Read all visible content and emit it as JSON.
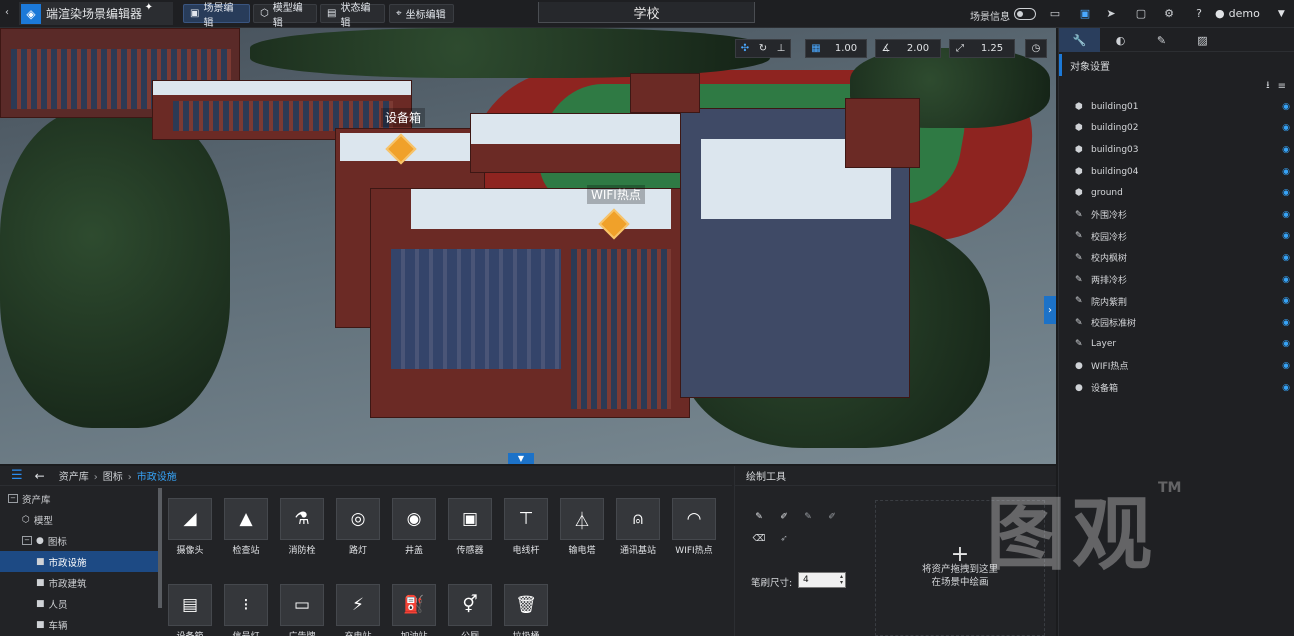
{
  "app": {
    "title": "端渲染场景编辑器",
    "spark": "✦"
  },
  "menu": [
    {
      "label": "场景编辑",
      "icon": "▣"
    },
    {
      "label": "模型编辑",
      "icon": "⬡"
    },
    {
      "label": "状态编辑",
      "icon": "▤"
    },
    {
      "label": "坐标编辑",
      "icon": "⌖"
    }
  ],
  "scene_title": "学校",
  "topright": {
    "scene_info_label": "场景信息",
    "user": "demo"
  },
  "viewport": {
    "grid_value": "1.00",
    "angle_value": "2.00",
    "scale_value": "1.25",
    "poi": [
      {
        "label": "设备箱"
      },
      {
        "label": "WIFI热点"
      }
    ]
  },
  "right_panel": {
    "header": "对象设置",
    "objects": [
      {
        "name": "building01",
        "icon": "cube"
      },
      {
        "name": "building02",
        "icon": "cube"
      },
      {
        "name": "building03",
        "icon": "cube"
      },
      {
        "name": "building04",
        "icon": "cube"
      },
      {
        "name": "ground",
        "icon": "cube"
      },
      {
        "name": "外围冷杉",
        "icon": "brush"
      },
      {
        "name": "校园冷杉",
        "icon": "brush"
      },
      {
        "name": "校内枫树",
        "icon": "brush"
      },
      {
        "name": "两排冷杉",
        "icon": "brush"
      },
      {
        "name": "院内紫荆",
        "icon": "brush"
      },
      {
        "name": "校园标准树",
        "icon": "brush"
      },
      {
        "name": "Layer",
        "icon": "brush"
      },
      {
        "name": "WIFI热点",
        "icon": "pin"
      },
      {
        "name": "设备箱",
        "icon": "pin"
      }
    ]
  },
  "bottom": {
    "breadcrumb": [
      "资产库",
      "图标",
      "市政设施"
    ],
    "tree": [
      {
        "label": "资产库",
        "level": 0,
        "toggle": "−",
        "icon": ""
      },
      {
        "label": "模型",
        "level": 1,
        "toggle": "",
        "icon": "⬡"
      },
      {
        "label": "图标",
        "level": 1,
        "toggle": "−",
        "icon": "●"
      },
      {
        "label": "市政设施",
        "level": 2,
        "toggle": "",
        "icon": "■",
        "selected": true
      },
      {
        "label": "市政建筑",
        "level": 2,
        "toggle": "",
        "icon": "■"
      },
      {
        "label": "人员",
        "level": 2,
        "toggle": "",
        "icon": "■"
      },
      {
        "label": "车辆",
        "level": 2,
        "toggle": "",
        "icon": "■"
      }
    ],
    "assets": [
      {
        "label": "摄像头",
        "glyph": "◢"
      },
      {
        "label": "检查站",
        "glyph": "▲"
      },
      {
        "label": "消防栓",
        "glyph": "⚗"
      },
      {
        "label": "路灯",
        "glyph": "◎"
      },
      {
        "label": "井盖",
        "glyph": "◉"
      },
      {
        "label": "传感器",
        "glyph": "▣"
      },
      {
        "label": "电线杆",
        "glyph": "⊤"
      },
      {
        "label": "输电塔",
        "glyph": "⏃"
      },
      {
        "label": "通讯基站",
        "glyph": "⍝"
      },
      {
        "label": "WIFI热点",
        "glyph": "◠"
      },
      {
        "label": "设备箱",
        "glyph": "▤"
      },
      {
        "label": "信号灯",
        "glyph": "⁝"
      },
      {
        "label": "广告牌",
        "glyph": "▭"
      },
      {
        "label": "充电站",
        "glyph": "⚡"
      },
      {
        "label": "加油站",
        "glyph": "⛽"
      },
      {
        "label": "公厕",
        "glyph": "⚥"
      },
      {
        "label": "垃圾桶",
        "glyph": "🗑"
      }
    ],
    "draw": {
      "title": "绘制工具",
      "brush_label": "笔刷尺寸:",
      "brush_value": "4",
      "drop_hint_line1": "将资产拖拽到这里",
      "drop_hint_line2": "在场景中绘画",
      "plus": "+"
    }
  },
  "watermark": {
    "text": "图观",
    "tm": "TM"
  }
}
